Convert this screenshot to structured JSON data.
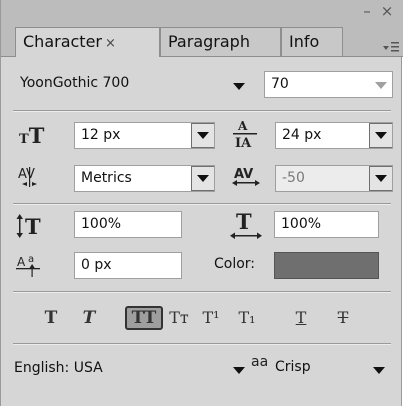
{
  "window": {
    "minimize_glyph": "–",
    "close_glyph": "×",
    "menu_glyph": "▾☰"
  },
  "tabs": [
    {
      "label": "Character",
      "close": "×",
      "active": true
    },
    {
      "label": "Paragraph",
      "active": false
    },
    {
      "label": "Info",
      "active": false
    }
  ],
  "font": {
    "family": "YoonGothic 700",
    "style": "70"
  },
  "metrics": {
    "size": "12 px",
    "leading": "24 px",
    "kerning": "Metrics",
    "tracking": "-50"
  },
  "scale": {
    "vertical": "100%",
    "horizontal": "100%",
    "baseline_shift": "0 px",
    "color_label": "Color:",
    "color_value": "#6f6f6f"
  },
  "style_buttons": [
    {
      "name": "faux-bold",
      "glyph": "T"
    },
    {
      "name": "faux-italic",
      "glyph": "T"
    },
    {
      "name": "all-caps",
      "glyph": "TT",
      "pressed": true
    },
    {
      "name": "small-caps",
      "glyph": "Tт"
    },
    {
      "name": "superscript",
      "glyph": "T¹"
    },
    {
      "name": "subscript",
      "glyph": "T₁"
    },
    {
      "name": "underline",
      "glyph": "T"
    },
    {
      "name": "strikethrough",
      "glyph": "T"
    }
  ],
  "language": {
    "value": "English: USA",
    "antialias_icon": "aa",
    "antialias": "Crisp"
  }
}
